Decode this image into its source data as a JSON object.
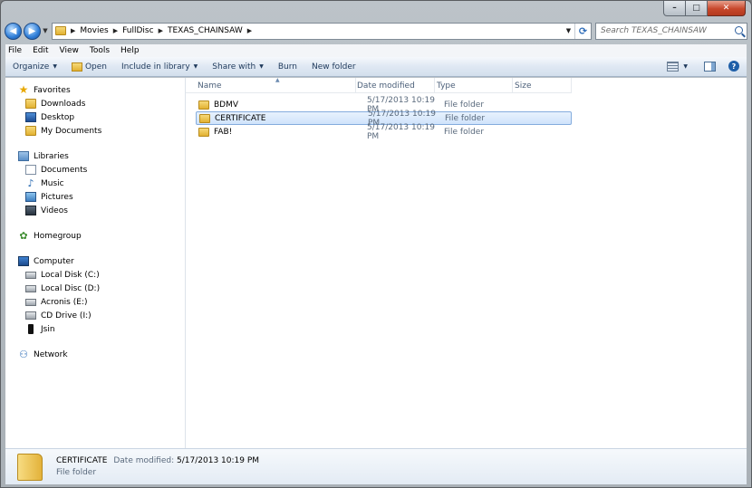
{
  "window": {
    "caption": {
      "minimize": "–",
      "maximize": "□",
      "close": "✕"
    }
  },
  "address": {
    "back_glyph": "◀",
    "forward_glyph": "▶",
    "crumbs": [
      "Movies",
      "FullDisc",
      "TEXAS_CHAINSAW"
    ],
    "refresh_glyph": "⟳"
  },
  "search": {
    "placeholder": "Search TEXAS_CHAINSAW"
  },
  "menubar": {
    "items": [
      "File",
      "Edit",
      "View",
      "Tools",
      "Help"
    ]
  },
  "commandbar": {
    "organize": "Organize",
    "open": "Open",
    "include_in_library": "Include in library",
    "share_with": "Share with",
    "burn": "Burn",
    "new_folder": "New folder"
  },
  "nav": {
    "favorites": {
      "label": "Favorites",
      "items": [
        "Downloads",
        "Desktop",
        "My Documents"
      ]
    },
    "libraries": {
      "label": "Libraries",
      "items": [
        "Documents",
        "Music",
        "Pictures",
        "Videos"
      ]
    },
    "homegroup": {
      "label": "Homegroup"
    },
    "computer": {
      "label": "Computer",
      "items": [
        "Local Disk (C:)",
        "Local Disc (D:)",
        "Acronis (E:)",
        "CD Drive (I:)",
        "Jsin"
      ]
    },
    "network": {
      "label": "Network"
    }
  },
  "columns": {
    "name": "Name",
    "date_modified": "Date modified",
    "type": "Type",
    "size": "Size"
  },
  "files": [
    {
      "name": "BDMV",
      "date": "5/17/2013 10:19 PM",
      "type": "File folder",
      "size": "",
      "selected": false
    },
    {
      "name": "CERTIFICATE",
      "date": "5/17/2013 10:19 PM",
      "type": "File folder",
      "size": "",
      "selected": true
    },
    {
      "name": "FAB!",
      "date": "5/17/2013 10:19 PM",
      "type": "File folder",
      "size": "",
      "selected": false
    }
  ],
  "details": {
    "name": "CERTIFICATE",
    "date_label": "Date modified:",
    "date_value": "5/17/2013 10:19 PM",
    "type": "File folder"
  }
}
